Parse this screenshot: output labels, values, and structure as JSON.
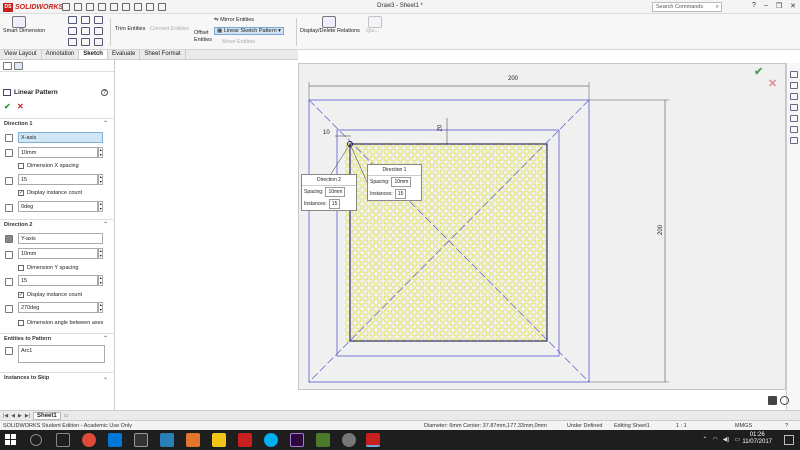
{
  "app": {
    "logo_text": "SOLIDWORKS",
    "window_title": "Draw3 - Sheet1 *",
    "search_placeholder": "Search Commands"
  },
  "commands": {
    "smart_dimension": "Smart Dimension",
    "trim_entities": "Trim Entities",
    "convert_entities": "Convert Entities",
    "offset_entities": "Offset Entities",
    "mirror_entities": "Mirror Entities",
    "linear_sketch_pattern": "Linear Sketch Pattern",
    "move_entities": "Move Entities",
    "display_delete_relations": "Display/Delete Relations",
    "quick_snaps": "Qui..."
  },
  "tabs": [
    "View Layout",
    "Annotation",
    "Sketch",
    "Evaluate",
    "Sheet Format"
  ],
  "active_tab": "Sketch",
  "property_manager": {
    "title": "Linear Pattern",
    "direction1": {
      "header": "Direction 1",
      "axis": "X-axis",
      "spacing": "10mm",
      "dimension_spacing_label": "Dimension X spacing",
      "instances": "15",
      "display_count_label": "Display instance count",
      "angle": "0deg"
    },
    "direction2": {
      "header": "Direction 2",
      "axis": "Y-axis",
      "spacing": "10mm",
      "dimension_spacing_label": "Dimension Y spacing",
      "instances": "15",
      "display_count_label": "Display instance count",
      "angle": "270deg",
      "angle_between_label": "Dimension angle between axes"
    },
    "entities_header": "Entities to Pattern",
    "entity": "Arc1",
    "skip_header": "Instances to Skip"
  },
  "drawing": {
    "dim_top": "200",
    "dim_right": "200",
    "dim_small_x": "10",
    "dim_small_y": "20",
    "callout_dir1": {
      "title": "Direction 1",
      "spacing_label": "Spacing:",
      "spacing": "10mm",
      "instances_label": "Instances:",
      "instances": "15"
    },
    "callout_dir2": {
      "title": "Direction 2",
      "spacing_label": "Spacing:",
      "spacing": "10mm",
      "instances_label": "Instances:",
      "instances": "15"
    }
  },
  "sheet_tab": "Sheet1",
  "status": {
    "edition": "SOLIDWORKS Student Edition - Academic Use Only",
    "measure": "Diameter: 6mm  Center: 37.87mm,177.33mm,0mm",
    "state": "Under Defined",
    "editing": "Editing Sheet1",
    "scale": "1 : 1",
    "units": "MMGS"
  },
  "taskbar": {
    "time": "01:26",
    "date": "11/07/2017"
  },
  "colors": {
    "accent": "#c8201e",
    "sketch_blue": "#4040c0",
    "pattern_yellow": "#e6e600"
  }
}
